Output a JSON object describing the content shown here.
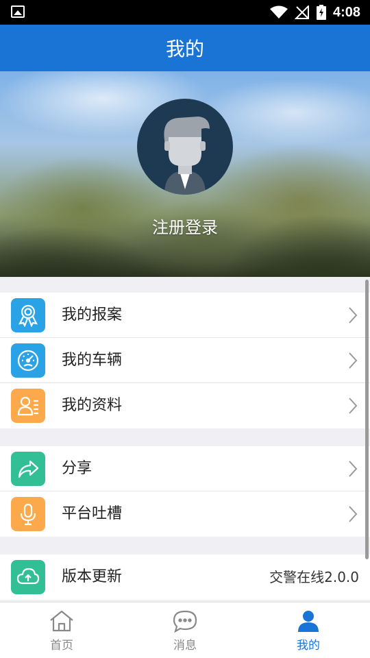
{
  "status_bar": {
    "time": "4:08"
  },
  "title_bar": {
    "title": "我的"
  },
  "profile": {
    "login_text": "注册登录"
  },
  "menu_groups": [
    [
      {
        "label": "我的报案",
        "icon": "award-ribbon-icon",
        "color": "#2aa3e6"
      },
      {
        "label": "我的车辆",
        "icon": "speedometer-icon",
        "color": "#2aa3e6"
      },
      {
        "label": "我的资料",
        "icon": "profile-card-icon",
        "color": "#fba94a"
      }
    ],
    [
      {
        "label": "分享",
        "icon": "share-arrow-icon",
        "color": "#33bf96"
      },
      {
        "label": "平台吐槽",
        "icon": "microphone-icon",
        "color": "#fba94a"
      }
    ],
    [
      {
        "label": "版本更新",
        "icon": "cloud-upload-icon",
        "color": "#33bf96",
        "value": "交警在线2.0.0"
      }
    ]
  ],
  "tab_bar": {
    "tabs": [
      {
        "label": "首页",
        "icon": "home-icon"
      },
      {
        "label": "消息",
        "icon": "chat-bubble-icon"
      },
      {
        "label": "我的",
        "icon": "user-icon",
        "active": true
      }
    ]
  },
  "colors": {
    "primary": "#1a74d6"
  }
}
